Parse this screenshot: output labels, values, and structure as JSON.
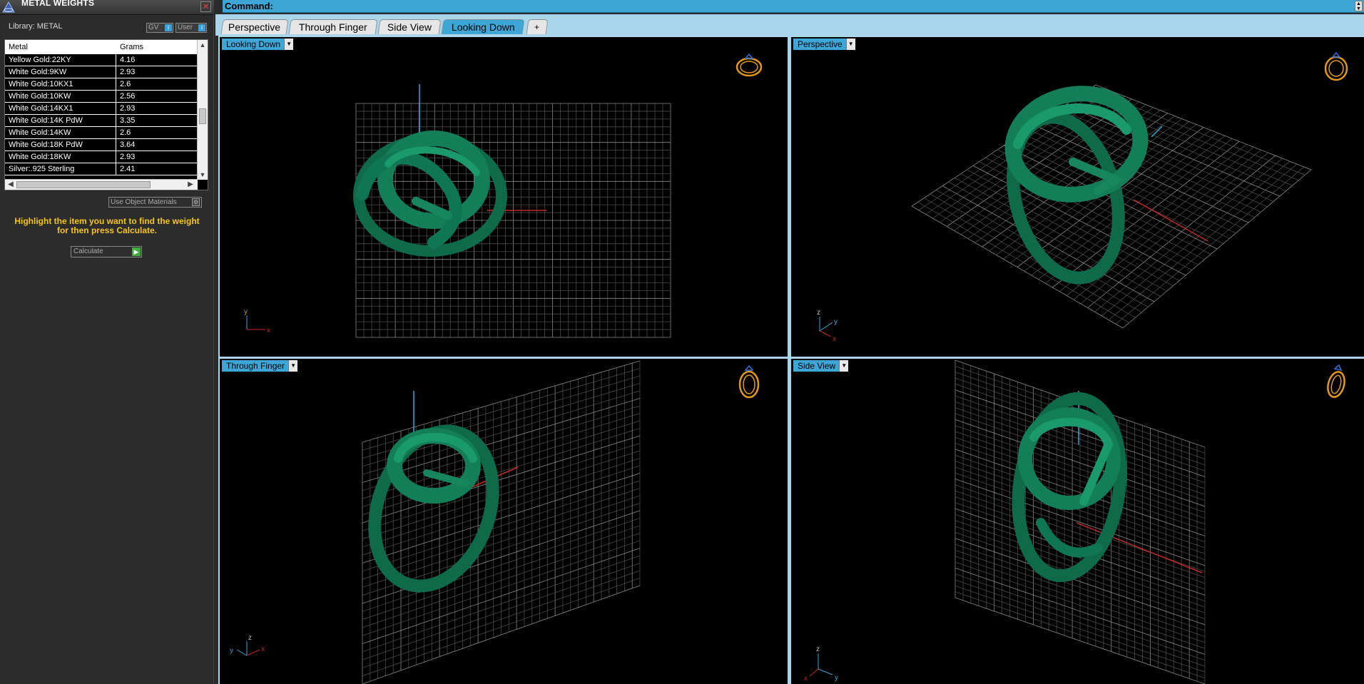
{
  "panel": {
    "title": "METAL WEIGHTS",
    "library_label": "Library: METAL",
    "btn_gv": "GV",
    "btn_user": "User",
    "columns": [
      "Metal",
      "Grams"
    ],
    "rows": [
      {
        "metal": "Yellow Gold:22KY",
        "grams": "4.16"
      },
      {
        "metal": "White Gold:9KW",
        "grams": "2.93"
      },
      {
        "metal": "White Gold:10KX1",
        "grams": "2.6"
      },
      {
        "metal": "White Gold:10KW",
        "grams": "2.56"
      },
      {
        "metal": "White Gold:14KX1",
        "grams": "2.93"
      },
      {
        "metal": "White Gold:14K PdW",
        "grams": "3.35"
      },
      {
        "metal": "White Gold:14KW",
        "grams": "2.6"
      },
      {
        "metal": "White Gold:18K PdW",
        "grams": "3.64"
      },
      {
        "metal": "White Gold:18KW",
        "grams": "2.93"
      },
      {
        "metal": "Silver:.925 Sterling",
        "grams": "2.41"
      }
    ],
    "use_object_materials": "Use Object Materials",
    "hint": "Highlight the item you want to find the weight for then press Calculate.",
    "calculate": "Calculate"
  },
  "command": {
    "label": "Command:"
  },
  "tabs": [
    {
      "label": "Perspective",
      "active": false
    },
    {
      "label": "Through Finger",
      "active": false
    },
    {
      "label": "Side View",
      "active": false
    },
    {
      "label": "Looking Down",
      "active": true
    }
  ],
  "tab_add_label": "+",
  "viewports": {
    "top_left": {
      "tag": "Looking Down",
      "axes": [
        "y",
        "x"
      ]
    },
    "top_right": {
      "tag": "Perspective",
      "axes": [
        "z",
        "y",
        "x"
      ]
    },
    "bottom_left": {
      "tag": "Through Finger",
      "axes": [
        "z",
        "y",
        "x"
      ]
    },
    "bottom_right": {
      "tag": "Side View",
      "axes": [
        "z",
        "x",
        "y"
      ]
    }
  },
  "colors": {
    "accent": "#3ea6d6",
    "ring": "#117a56",
    "grid": "#6e6e6e",
    "axis_red": "#c22a2a",
    "axis_blue": "#3ea6d6",
    "hint": "#f5c518"
  }
}
